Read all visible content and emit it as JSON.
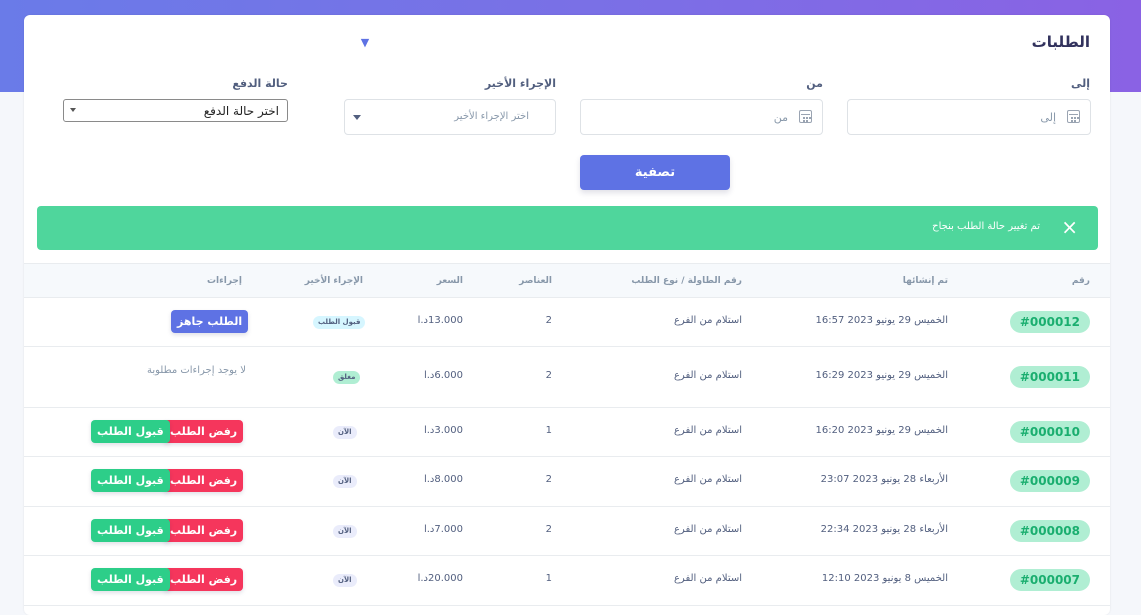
{
  "page": {
    "title": "الطلبات"
  },
  "filters": {
    "to_label": "إلى",
    "to_placeholder": "إلى",
    "from_label": "من",
    "from_placeholder": "من",
    "last_action_label": "الإجراء الأخير",
    "last_action_placeholder": "اختر الإجراء الأخير",
    "payment_label": "حالة الدفع",
    "payment_value": "اختر حالة الدفع",
    "filter_button": "تصفية"
  },
  "alert": {
    "message": "تم تغيير حالة الطلب بنجاح",
    "close": "×"
  },
  "table": {
    "headers": {
      "number": "رقم",
      "created": "تم إنشائها",
      "table_type": "رقم الطاولة / نوع الطلب",
      "items": "العناصر",
      "price": "السعر",
      "last_action": "الإجراء الأخير",
      "actions": "إجراءات"
    },
    "rows": [
      {
        "number": "#000012",
        "created": "الخميس 29 يونيو 2023 16:57",
        "type": "استلام من الفرع",
        "items": "2",
        "price": "13.000د.ا",
        "status": "قبول الطلب",
        "status_color": "#d6f6ff",
        "actions": "ready"
      },
      {
        "number": "#000011",
        "created": "الخميس 29 يونيو 2023 16:29",
        "type": "استلام من الفرع",
        "items": "2",
        "price": "6.000د.ا",
        "status": "مغلق",
        "status_color": "#b0eed3",
        "actions": "none"
      },
      {
        "number": "#000010",
        "created": "الخميس 29 يونيو 2023 16:20",
        "type": "استلام من الفرع",
        "items": "1",
        "price": "3.000د.ا",
        "status": "الآن",
        "status_color": "#eaecfb",
        "actions": "pending"
      },
      {
        "number": "#000009",
        "created": "الأربعاء 28 يونيو 2023 23:07",
        "type": "استلام من الفرع",
        "items": "2",
        "price": "8.000د.ا",
        "status": "الآن",
        "status_color": "#eaecfb",
        "actions": "pending"
      },
      {
        "number": "#000008",
        "created": "الأربعاء 28 يونيو 2023 22:34",
        "type": "استلام من الفرع",
        "items": "2",
        "price": "7.000د.ا",
        "status": "الآن",
        "status_color": "#eaecfb",
        "actions": "pending"
      },
      {
        "number": "#000007",
        "created": "الخميس 8 يونيو 2023 12:10",
        "type": "استلام من الفرع",
        "items": "1",
        "price": "20.000د.ا",
        "status": "الآن",
        "status_color": "#eaecfb",
        "actions": "pending"
      }
    ],
    "labels": {
      "ready": "الطلب جاهز",
      "reject": "رفض الطلب",
      "accept": "قبول الطلب",
      "no_actions": "لا يوجد إجراءات مطلوبة"
    }
  },
  "colors": {
    "primary": "#5e72e4",
    "success": "#2dce89",
    "danger": "#f5365c",
    "alert": "#4fd69c"
  }
}
